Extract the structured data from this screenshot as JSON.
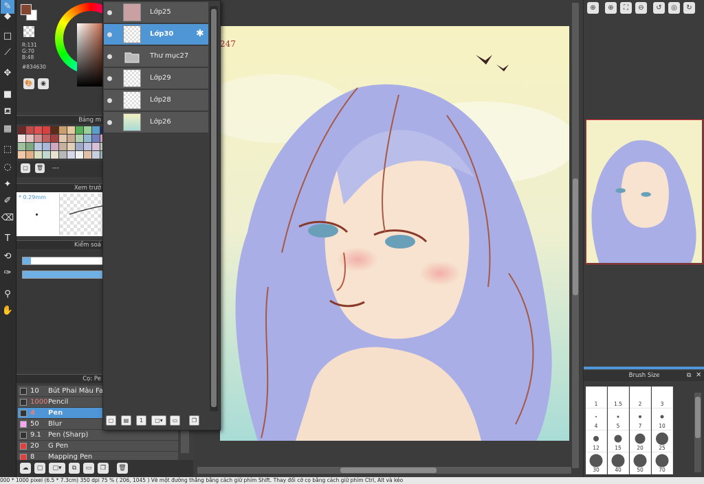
{
  "color": {
    "main_hex": "#834630",
    "r_label": "R:131",
    "g_label": "G:70",
    "b_label": "B:48",
    "hex_label": "#834630",
    "accent": "#4e96d6"
  },
  "panels": {
    "palette_title": "Bảng m",
    "preview_title": "Xem trướ",
    "control_title": "Kiểm soá",
    "brush_title": "Cọ: Pe",
    "brush_size_title": "Brush Size",
    "palette_name": "---",
    "brush_preview_size": "* 0.29mm"
  },
  "toolbar_icons": [
    "pen-icon",
    "eraser-icon",
    "rect-icon",
    "line-icon",
    "move-icon",
    "fill-rect-icon",
    "bucket-icon",
    "gradient-icon",
    "select-rect-icon",
    "lasso-icon",
    "magic-wand-icon",
    "select-pen-icon",
    "select-eraser-icon",
    "text-icon",
    "transform-icon",
    "dropper-pen-icon",
    "eyedropper-icon",
    "hand-icon"
  ],
  "layers": [
    {
      "name": "Lớp25",
      "thumb": "#caa0a2",
      "selected": false,
      "folder": false
    },
    {
      "name": "Lớp30",
      "thumb": "checker",
      "selected": true,
      "folder": false
    },
    {
      "name": "Thư mục27",
      "thumb": "folder",
      "selected": false,
      "folder": true
    },
    {
      "name": "Lớp29",
      "thumb": "checker",
      "selected": false,
      "folder": false
    },
    {
      "name": "Lớp28",
      "thumb": "checker",
      "selected": false,
      "folder": false
    },
    {
      "name": "Lớp26",
      "thumb": "sky",
      "selected": false,
      "folder": false
    }
  ],
  "brushes": [
    {
      "size": "10",
      "name": "Bút Phai Màu Fake",
      "swatch": "#333333",
      "selected": false,
      "size_color": "#eeeeee"
    },
    {
      "size": "1000",
      "name": "Pencil",
      "swatch": "#333333",
      "selected": false,
      "size_color": "#f08080"
    },
    {
      "size": "4",
      "name": "Pen",
      "swatch": "#333333",
      "selected": true,
      "size_color": "#f08080"
    },
    {
      "size": "50",
      "name": "Blur",
      "swatch": "#f6a6f0",
      "selected": false,
      "size_color": "#eeeeee"
    },
    {
      "size": "9.1",
      "name": "Pen (Sharp)",
      "swatch": "#333333",
      "selected": false,
      "size_color": "#eeeeee"
    },
    {
      "size": "20",
      "name": "G Pen",
      "swatch": "#e04040",
      "selected": false,
      "size_color": "#eeeeee"
    },
    {
      "size": "8",
      "name": "Mapping Pen",
      "swatch": "#e04040",
      "selected": false,
      "size_color": "#eeeeee"
    }
  ],
  "brush_sizes": [
    {
      "label": "1",
      "dot": 0
    },
    {
      "label": "1.5",
      "dot": 0
    },
    {
      "label": "2",
      "dot": 0
    },
    {
      "label": "3",
      "dot": 0
    },
    {
      "label": "4",
      "dot": 2
    },
    {
      "label": "5",
      "dot": 3
    },
    {
      "label": "7",
      "dot": 4
    },
    {
      "label": "10",
      "dot": 5
    },
    {
      "label": "12",
      "dot": 8
    },
    {
      "label": "15",
      "dot": 11
    },
    {
      "label": "20",
      "dot": 15
    },
    {
      "label": "25",
      "dot": 18
    },
    {
      "label": "30",
      "dot": 19
    },
    {
      "label": "40",
      "dot": 19
    },
    {
      "label": "50",
      "dot": 19
    },
    {
      "label": "70",
      "dot": 19
    }
  ],
  "status": {
    "text": "000 * 1000 pixel   (6.5 * 7.3cm)   350 dpi   75 %   ( 206, 1045 )   Vẽ một đường thẳng bằng cách giữ phím Shift. Thay đổi cỡ cọ bằng cách giữ phím Ctrl, Alt và kéo"
  },
  "canvas_signature": "247"
}
